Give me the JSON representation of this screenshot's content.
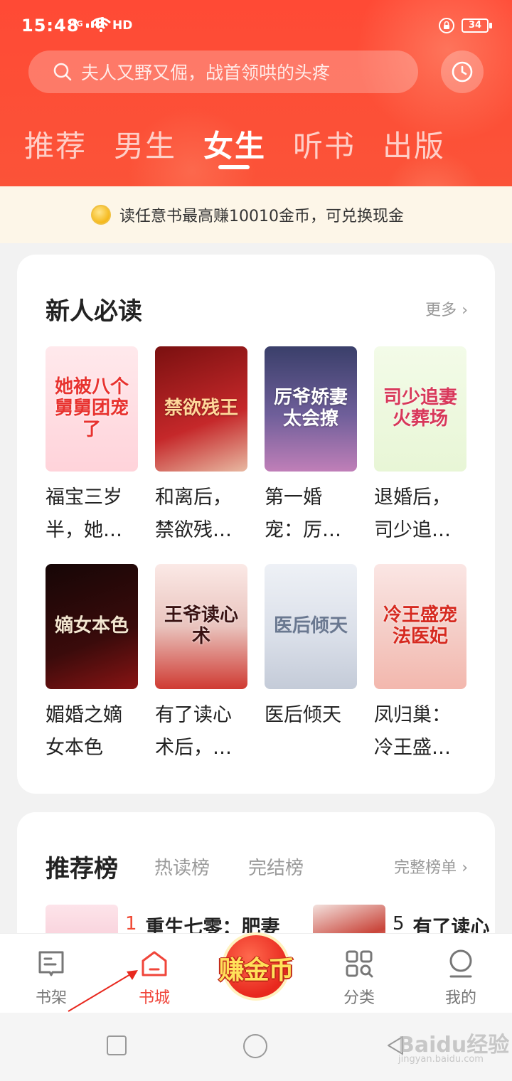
{
  "status_bar": {
    "time": "15:48",
    "network": "4G",
    "hd": "HD",
    "battery": "34"
  },
  "search": {
    "placeholder": "夫人又野又倔，战首领哄的头疼"
  },
  "tabs": [
    {
      "label": "推荐",
      "active": false
    },
    {
      "label": "男生",
      "active": false
    },
    {
      "label": "女生",
      "active": true
    },
    {
      "label": "听书",
      "active": false
    },
    {
      "label": "出版",
      "active": false
    }
  ],
  "banner": {
    "text": "读任意书最高赚10010金币，可兑换现金"
  },
  "new_reader": {
    "title": "新人必读",
    "more": "更多",
    "books": [
      {
        "title": "福宝三岁半，她…",
        "cover_text": "她被八个舅舅团宠了"
      },
      {
        "title": "和离后，禁欲残…",
        "cover_text": "禁欲残王"
      },
      {
        "title": "第一婚宠：厉…",
        "cover_text": "厉爷娇妻太会撩"
      },
      {
        "title": "退婚后，司少追…",
        "cover_text": "司少追妻火葬场"
      },
      {
        "title": "媚婚之嫡女本色",
        "cover_text": "嫡女本色"
      },
      {
        "title": "有了读心术后，…",
        "cover_text": "王爷读心术"
      },
      {
        "title": "医后倾天",
        "cover_text": "医后倾天"
      },
      {
        "title": "凤归巢：冷王盛…",
        "cover_text": "冷王盛宠法医妃"
      }
    ]
  },
  "ranking": {
    "title": "推荐榜",
    "tabs": [
      "热读榜",
      "完结榜"
    ],
    "full_list": "完整榜单",
    "items": [
      {
        "rank": "1",
        "name": "重生七零：肥妻"
      },
      {
        "rank": "5",
        "name": "有了读心"
      }
    ]
  },
  "bottom_nav": {
    "bookshelf": "书架",
    "bookstore": "书城",
    "earn": "赚金币",
    "category": "分类",
    "mine": "我的"
  },
  "watermark": {
    "text": "Baidu经验",
    "sub": "jingyan.baidu.com"
  },
  "colors": {
    "brand_red": "#fb5338",
    "active_nav": "#f0453a",
    "banner_bg": "#fdf6e8"
  }
}
